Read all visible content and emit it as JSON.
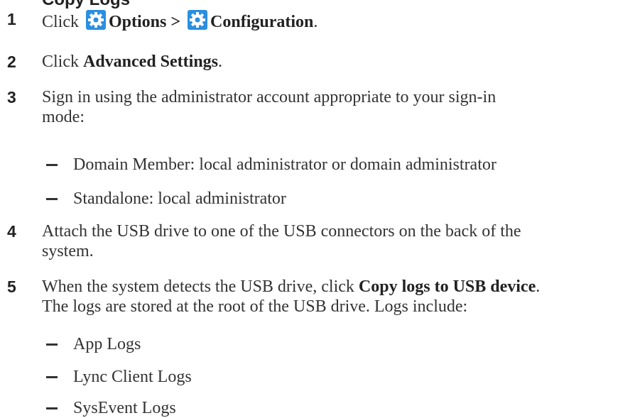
{
  "heading_partial": "Copy Logs",
  "steps": [
    {
      "number": "1",
      "click": "Click",
      "options": "Options >",
      "configuration": "Configuration",
      "period": "."
    },
    {
      "number": "2",
      "click": "Click",
      "target": "Advanced Settings",
      "period": "."
    },
    {
      "number": "3",
      "line1": "Sign in using the administrator account appropriate to your sign-in",
      "line2": "mode:"
    },
    {
      "number": "4",
      "line1": "Attach the USB drive to one of the USB connectors on the back of the",
      "line2": "system."
    },
    {
      "number": "5",
      "prefix": "When the system detects the USB drive, click",
      "target": "Copy logs to USB device",
      "period": ".",
      "line2": "The logs are stored at the root of the USB drive. Logs include:"
    }
  ],
  "signin_modes": [
    "Domain Member: local administrator or domain administrator",
    "Standalone: local administrator"
  ],
  "logs": [
    "App Logs",
    "Lync Client Logs",
    "SysEvent Logs"
  ],
  "icons": {
    "options": "gear-icon",
    "configuration": "gear-icon"
  },
  "colors": {
    "icon_blue": "#2a8fe0",
    "text": "#333333"
  }
}
